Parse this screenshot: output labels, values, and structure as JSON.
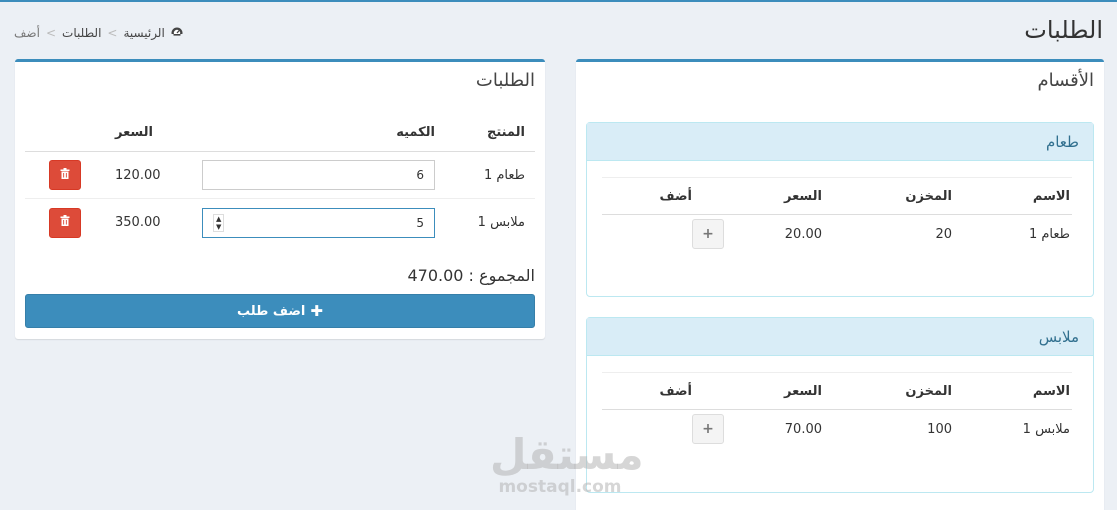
{
  "header": {
    "title": "الطلبات",
    "breadcrumb": {
      "home": "الرئيسية",
      "orders": "الطلبات",
      "current": "أضف"
    }
  },
  "orders": {
    "title": "الطلبات",
    "columns": {
      "product": "المنتج",
      "quantity": "الكميه",
      "price": "السعر"
    },
    "rows": [
      {
        "product": "طعام 1",
        "quantity": "6",
        "price": "120.00"
      },
      {
        "product": "ملابس 1",
        "quantity": "5",
        "price": "350.00"
      }
    ],
    "total": "المجموع : 470.00",
    "add_button": "اضف طلب"
  },
  "categories": {
    "title": "الأقسام",
    "columns": {
      "name": "الاسم",
      "stock": "المخزن",
      "price": "السعر",
      "add": "أضف"
    },
    "panels": [
      {
        "name": "طعام",
        "rows": [
          {
            "name": "طعام 1",
            "stock": "20",
            "price": "20.00"
          }
        ]
      },
      {
        "name": "ملابس",
        "rows": [
          {
            "name": "ملابس 1",
            "stock": "100",
            "price": "70.00"
          }
        ]
      }
    ]
  },
  "watermark": {
    "arabic": "مستقل",
    "latin": "mostaql.com"
  },
  "colors": {
    "primary": "#3c8dbc",
    "danger": "#dd4b39",
    "panel_head": "#d9edf7",
    "background": "#ecf0f5"
  }
}
